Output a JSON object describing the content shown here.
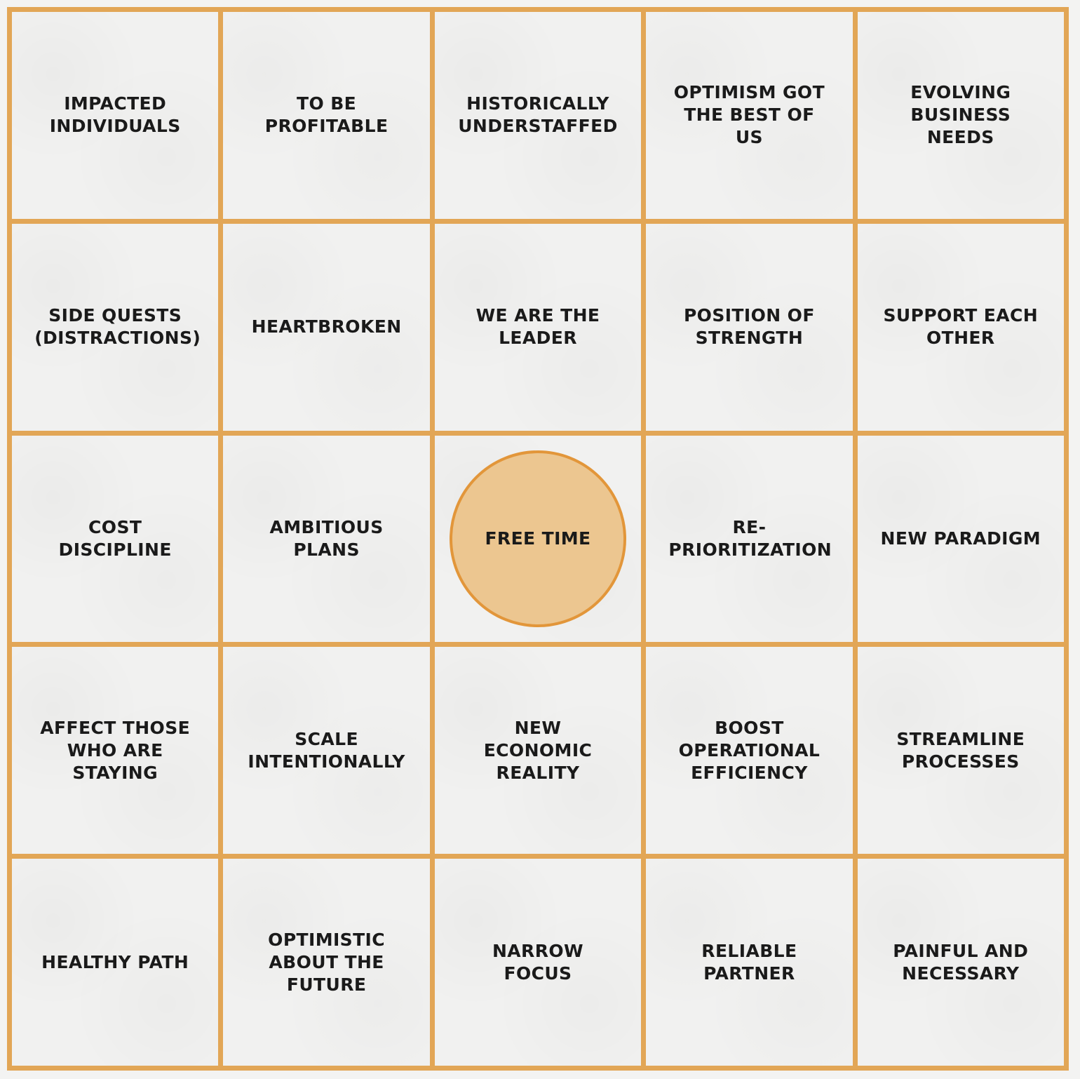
{
  "board": {
    "cells": [
      "IMPACTED INDIVIDUALS",
      "TO BE PROFITABLE",
      "HISTORICALLY UNDERSTAFFED",
      "OPTIMISM GOT THE BEST OF US",
      "EVOLVING BUSINESS NEEDS",
      "SIDE QUESTS (DISTRACTIONS)",
      "HEARTBROKEN",
      "WE ARE THE LEADER",
      "POSITION OF STRENGTH",
      "SUPPORT EACH OTHER",
      "COST DISCIPLINE",
      "AMBITIOUS PLANS",
      "FREE TIME",
      "RE-PRIORITIZATION",
      "NEW PARADIGM",
      "AFFECT THOSE WHO ARE STAYING",
      "SCALE INTENTIONALLY",
      "NEW ECONOMIC REALITY",
      "BOOST OPERATIONAL EFFICIENCY",
      "STREAMLINE PROCESSES",
      "HEALTHY PATH",
      "OPTIMISTIC ABOUT THE FUTURE",
      "NARROW FOCUS",
      "RELIABLE PARTNER",
      "PAINFUL AND NECESSARY"
    ]
  },
  "colors": {
    "grid_line": "#e2a656",
    "cell_background": "#f1f1f0",
    "free_space_fill": "#ecc690",
    "free_space_border": "#e2963a",
    "text": "#1a1a1a"
  }
}
